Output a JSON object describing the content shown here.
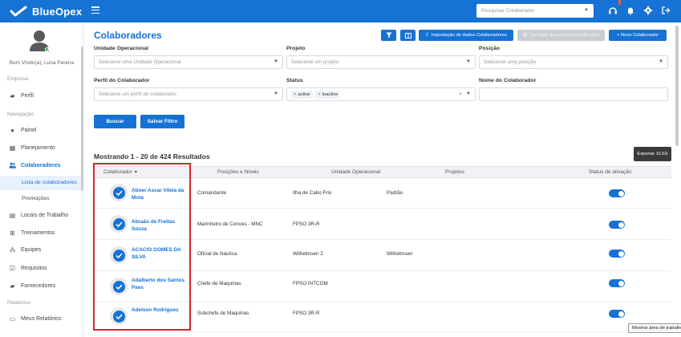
{
  "app": {
    "name": "BlueOpex"
  },
  "topbar": {
    "search_placeholder": "Pesquisar Colaborador",
    "icons": [
      "headset-icon",
      "bell-icon",
      "gear-icon",
      "logout-icon"
    ]
  },
  "sidebar": {
    "welcome": "Bem Vindo(a), Luna Pereira",
    "sections": {
      "empresa": "Empresa",
      "navegacao": "Navegação",
      "relatorios": "Relatórios"
    },
    "items": {
      "perfil": "Perfil",
      "painel": "Painel",
      "planejamento": "Planejamento",
      "colaboradores": "Colaboradores",
      "lista": "Lista de colaboradores",
      "promocoes": "Promoções",
      "locais": "Locais de Trabalho",
      "treinamentos": "Treinamentos",
      "equipes": "Equipes",
      "requisitos": "Requisitos",
      "fornecedores": "Fornecedores",
      "meus_relatorios": "Meus Relatórios"
    }
  },
  "page": {
    "title": "Colaboradores",
    "buttons": {
      "import": "Importação de dados Colaboradores",
      "upload": "Carregar documentos/certificados",
      "new": "+ Novo Colaborador"
    }
  },
  "filters": {
    "unidade": {
      "label": "Unidade Operacional",
      "placeholder": "Selecione uma Unidade Operacional"
    },
    "projeto": {
      "label": "Projeto",
      "placeholder": "Selecione um projeto"
    },
    "posicao": {
      "label": "Posição",
      "placeholder": "Selecione uma posição"
    },
    "perfil": {
      "label": "Perfil do Colaborador",
      "placeholder": "Selecione um perfil de colaborador"
    },
    "status": {
      "label": "Status",
      "tags": [
        "active",
        "inactive"
      ]
    },
    "nome": {
      "label": "Nome do Colaborador",
      "value": ""
    },
    "buscar": "Buscar",
    "salvar": "Salvar Filtro"
  },
  "results": {
    "summary": "Mostrando 1 - 20 de 424 Resultados",
    "export": "Exportar XLSX"
  },
  "table": {
    "headers": {
      "colaborador": "Colaborador",
      "posicoes": "Posições e Níveis",
      "unidade": "Unidade Operacional",
      "projetos": "Projetos",
      "status": "Status de ativação"
    },
    "rows": [
      {
        "name": "Abner Ascar Vilela da Mota",
        "position": "Comandante",
        "unit": "Ilha de Cabo Frio",
        "project": "Padrão",
        "active": true
      },
      {
        "name": "Abraão de Freitas Souza",
        "position": "Marinheiro de Conves - MNC",
        "unit": "FPSO 3R-R",
        "project": "",
        "active": true
      },
      {
        "name": "ACACIO GOMES DA SILVA",
        "position": "Oficial de Náutica",
        "unit": "Wilhelmsen 2",
        "project": "Wilhelmsen",
        "active": true
      },
      {
        "name": "Adalberto dos Santos Paes",
        "position": "Chefe de Maquinas",
        "unit": "FPSO INTCOM",
        "project": "",
        "active": true
      },
      {
        "name": "Adelson Rodrigues",
        "position": "Subchefe de Maquinas",
        "unit": "FPSO 3R-R",
        "project": "",
        "active": true
      }
    ]
  },
  "tooltip": "Mostrar área de trabalho",
  "colors": {
    "primary": "#1672d4",
    "highlight": "#d9232d"
  }
}
